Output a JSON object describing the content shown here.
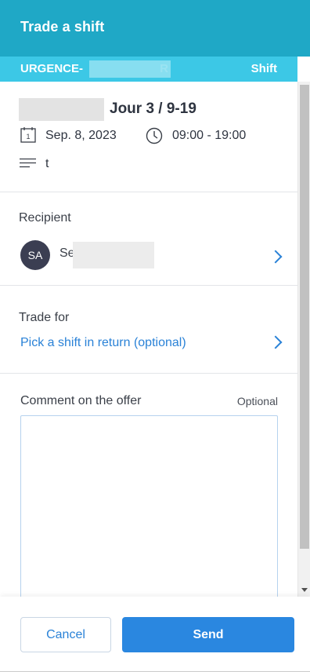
{
  "header": {
    "title": "Trade a shift"
  },
  "subheader": {
    "unit_prefix": "URGENCE- ",
    "unit_suffix": "R",
    "kind": "Shift"
  },
  "shift": {
    "name": "Jour 3 / 9-19",
    "date": "Sep. 8, 2023",
    "time": "09:00 - 19:00",
    "note": "t",
    "icons": {
      "date": "calendar-icon",
      "time": "clock-icon",
      "note": "notes-icon"
    }
  },
  "recipient": {
    "label": "Recipient",
    "avatar_initials": "SA",
    "name_prefix": "Se"
  },
  "trade_for": {
    "label": "Trade for",
    "pick_link": "Pick a shift in return (optional)"
  },
  "comment": {
    "label": "Comment on the offer",
    "optional": "Optional",
    "value": ""
  },
  "footer": {
    "cancel": "Cancel",
    "send": "Send"
  },
  "colors": {
    "header": "#1fa8c6",
    "subheader": "#3cc8e6",
    "accent": "#2a87e0",
    "avatar": "#3b3e52"
  }
}
